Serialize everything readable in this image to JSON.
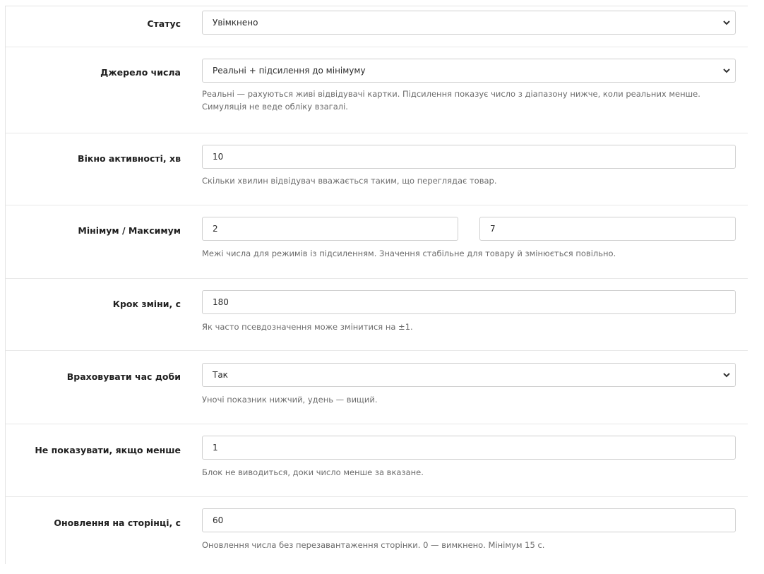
{
  "form": {
    "status": {
      "label": "Статус",
      "value": "Увімкнено"
    },
    "source": {
      "label": "Джерело числа",
      "value": "Реальні + підсилення до мінімуму",
      "help_line1": "Реальні — рахуються живі відвідувачі картки. Підсилення показує число з діапазону нижче, коли реальних менше.",
      "help_line2": "Симуляція не веде обліку взагалі."
    },
    "window": {
      "label": "Вікно активності, хв",
      "value": "10",
      "help": "Скільки хвилин відвідувач вважається таким, що переглядає товар."
    },
    "minmax": {
      "label": "Мінімум / Максимум",
      "min_value": "2",
      "max_value": "7",
      "help": "Межі числа для режимів із підсиленням. Значення стабільне для товару й змінюється повільно."
    },
    "step": {
      "label": "Крок зміни, с",
      "value": "180",
      "help": "Як часто псевдозначення може змінитися на ±1."
    },
    "daytime": {
      "label": "Враховувати час доби",
      "value": "Так",
      "help": "Уночі показник нижчий, удень — вищий."
    },
    "threshold": {
      "label": "Не показувати, якщо менше",
      "value": "1",
      "help": "Блок не виводиться, доки число менше за вказане."
    },
    "refresh": {
      "label": "Оновлення на сторінці, с",
      "value": "60",
      "help": "Оновлення числа без перезавантаження сторінки. 0 — вимкнено. Мінімум 15 с."
    }
  },
  "icons": {
    "select_arrow": "chevron-down-icon"
  }
}
